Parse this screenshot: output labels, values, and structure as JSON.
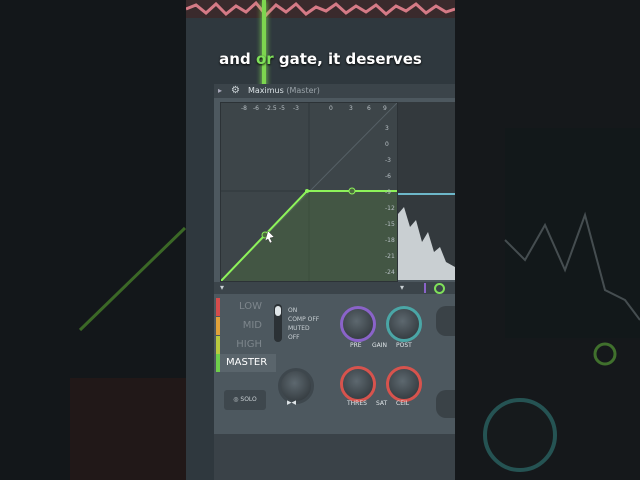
{
  "caption": {
    "before": "and ",
    "highlight": "or",
    "after": " gate, it deserves"
  },
  "plugin": {
    "title": "Maximus",
    "subtitle": "(Master)",
    "top_scale": [
      "-8",
      "-6",
      "-2.5",
      "-5",
      "-3",
      "0",
      "3",
      "6",
      "9"
    ],
    "left_scale": [
      "3",
      "0",
      "-3",
      "-6",
      "-9",
      "-12",
      "-15",
      "-18",
      "-21",
      "-24"
    ],
    "bands": [
      {
        "label": "LOW",
        "color": "#d44c4c"
      },
      {
        "label": "MID",
        "color": "#e0a13a"
      },
      {
        "label": "HIGH",
        "color": "#b9c93f"
      }
    ],
    "master_label": "MASTER",
    "modes": [
      "ON",
      "COMP OFF",
      "MUTED",
      "OFF"
    ],
    "knob_labels": {
      "pre": "PRE",
      "gain": "GAIN",
      "post": "POST",
      "thres": "THRES",
      "sat": "SAT",
      "ceil": "CEIL"
    },
    "solo_label": "SOLO",
    "colors": {
      "accent": "#7fe05a",
      "pre": "#8a63c9",
      "post": "#4aa6a6",
      "thres": "#d7534d",
      "ceil": "#d7534d"
    }
  }
}
